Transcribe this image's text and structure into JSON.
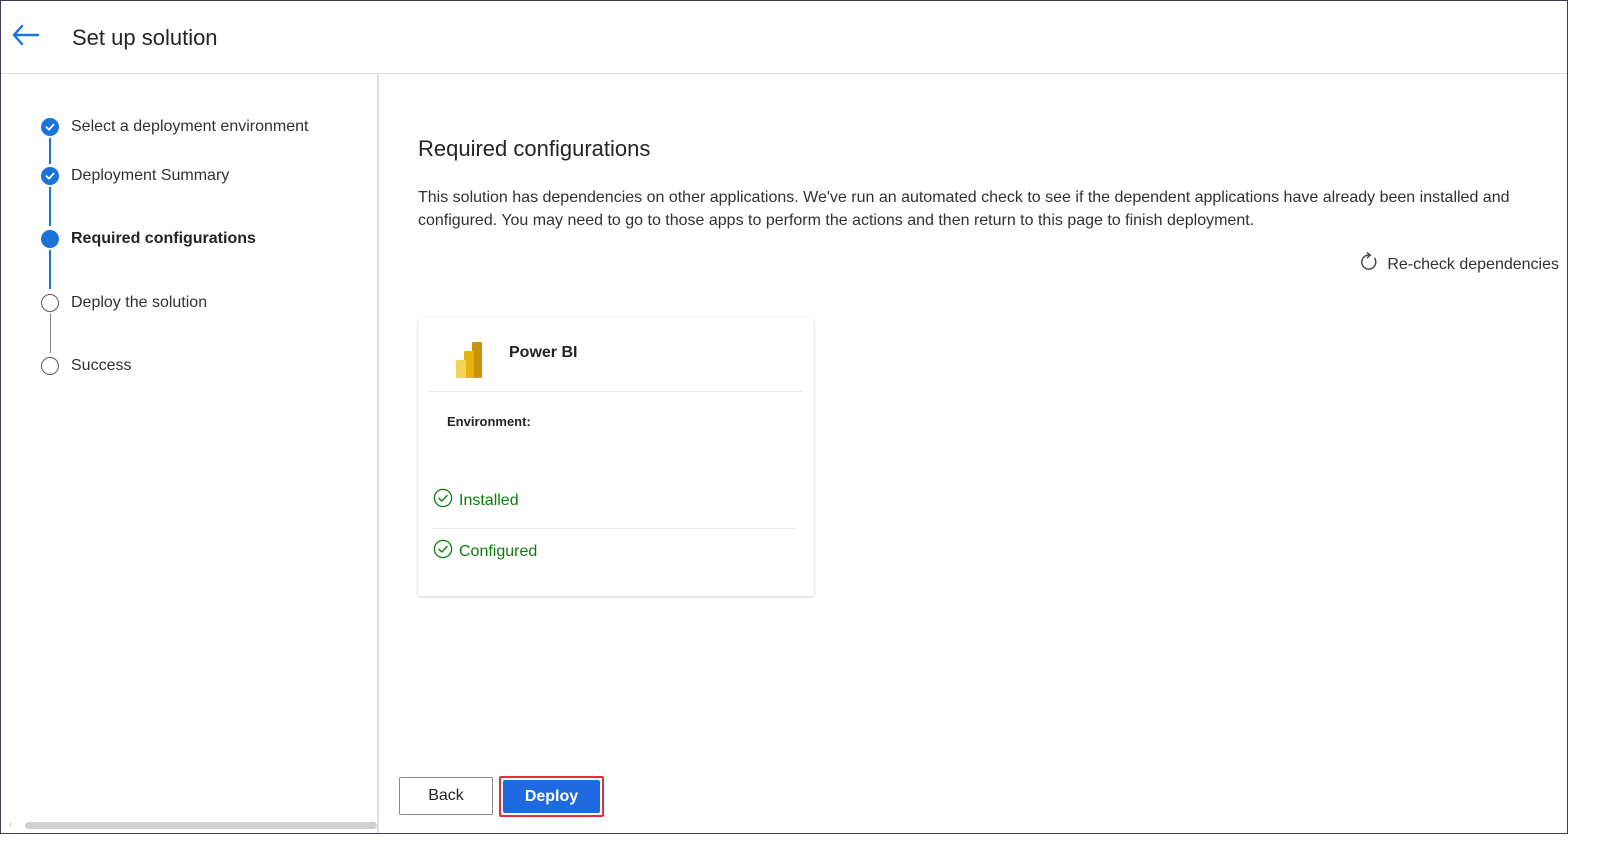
{
  "header": {
    "back_icon": "arrow-left-icon",
    "title": "Set up solution"
  },
  "stepper": {
    "steps": [
      {
        "label": "Select a deployment environment",
        "state": "done"
      },
      {
        "label": "Deployment Summary",
        "state": "done"
      },
      {
        "label": "Required configurations",
        "state": "current"
      },
      {
        "label": "Deploy the solution",
        "state": "todo"
      },
      {
        "label": "Success",
        "state": "todo"
      }
    ]
  },
  "main": {
    "title": "Required configurations",
    "description": "This solution has dependencies on other applications. We've run an automated check to see if the dependent applications have already been installed and configured. You may need to go to those apps to perform the actions and then return to this page to finish deployment.",
    "recheck_label": "Re-check dependencies",
    "recheck_icon": "refresh-icon",
    "card": {
      "app_name": "Power BI",
      "app_icon": "power-bi-logo",
      "environment_label": "Environment:",
      "statuses": [
        {
          "label": "Installed",
          "icon": "check-circle-icon"
        },
        {
          "label": "Configured",
          "icon": "check-circle-icon"
        }
      ]
    }
  },
  "footer": {
    "back_label": "Back",
    "deploy_label": "Deploy"
  },
  "colors": {
    "accent": "#1a73d9",
    "success": "#107c10",
    "primary_button": "#1f6ae0",
    "highlight_outline": "#e0303a"
  }
}
